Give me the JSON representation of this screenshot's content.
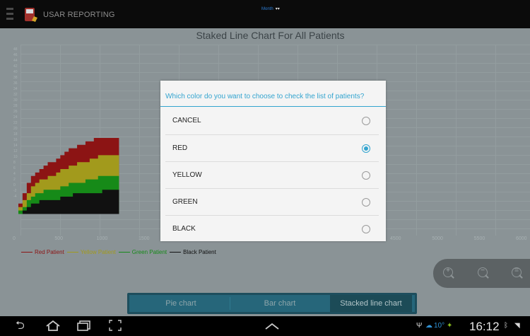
{
  "app": {
    "title": "USAR REPORTING",
    "period_selector": "Month"
  },
  "chart": {
    "title": "Staked Line Chart For All Patients",
    "x_ticks": [
      "0",
      "500",
      "1000",
      "1500",
      "4500",
      "5000",
      "5500",
      "6000"
    ],
    "y_ticks": [
      "48",
      "46",
      "44",
      "42",
      "40",
      "38",
      "36",
      "34",
      "32",
      "30",
      "28",
      "26",
      "24",
      "22",
      "20",
      "18",
      "16",
      "14",
      "12",
      "10",
      "8",
      "6",
      "4",
      "2",
      "0",
      "-2",
      "-4"
    ],
    "legend": [
      {
        "label": "Red Patient",
        "color": "#8c1414"
      },
      {
        "label": "Yellow Patient",
        "color": "#a29a1c"
      },
      {
        "label": "Green Patient",
        "color": "#168a18"
      },
      {
        "label": "Black Patient",
        "color": "#111111"
      }
    ]
  },
  "chart_data": {
    "type": "area",
    "title": "Staked Line Chart For All Patients",
    "x": [
      0,
      50,
      100,
      150,
      200,
      250,
      300,
      350,
      400,
      450,
      500,
      550,
      600,
      650,
      700,
      750,
      800,
      850,
      900,
      950,
      1000,
      1100,
      1200
    ],
    "series": [
      {
        "name": "Black Patient",
        "values": [
          0,
          1,
          2,
          3,
          3,
          4,
          4,
          4,
          4,
          4,
          5,
          5,
          5,
          6,
          6,
          6,
          6,
          6,
          6,
          6,
          7,
          7,
          7
        ]
      },
      {
        "name": "Green Patient",
        "values": [
          1,
          2,
          4,
          5,
          6,
          6,
          7,
          7,
          7,
          7,
          8,
          8,
          9,
          9,
          9,
          9,
          10,
          10,
          10,
          11,
          11,
          11,
          11
        ]
      },
      {
        "name": "Yellow Patient",
        "values": [
          2,
          4,
          6,
          8,
          9,
          10,
          10,
          11,
          11,
          12,
          13,
          13,
          14,
          14,
          15,
          15,
          15,
          16,
          16,
          17,
          17,
          17,
          17
        ]
      },
      {
        "name": "Red Patient",
        "values": [
          3,
          6,
          9,
          11,
          12,
          13,
          14,
          15,
          15,
          16,
          17,
          18,
          19,
          19,
          20,
          20,
          21,
          21,
          22,
          22,
          22,
          22,
          22
        ]
      }
    ],
    "xlim": [
      0,
      6000
    ],
    "ylim": [
      -4,
      48
    ]
  },
  "dialog": {
    "title": "Which color do you want to choose to check the list of patients?",
    "options": [
      {
        "label": "CANCEL",
        "selected": false
      },
      {
        "label": "RED",
        "selected": true
      },
      {
        "label": "YELLOW",
        "selected": false
      },
      {
        "label": "GREEN",
        "selected": false
      },
      {
        "label": "BLACK",
        "selected": false
      }
    ]
  },
  "tabs": [
    "Pie chart",
    "Bar chart",
    "Stacked line chart"
  ],
  "status": {
    "time": "16:12",
    "temp": "10°"
  }
}
